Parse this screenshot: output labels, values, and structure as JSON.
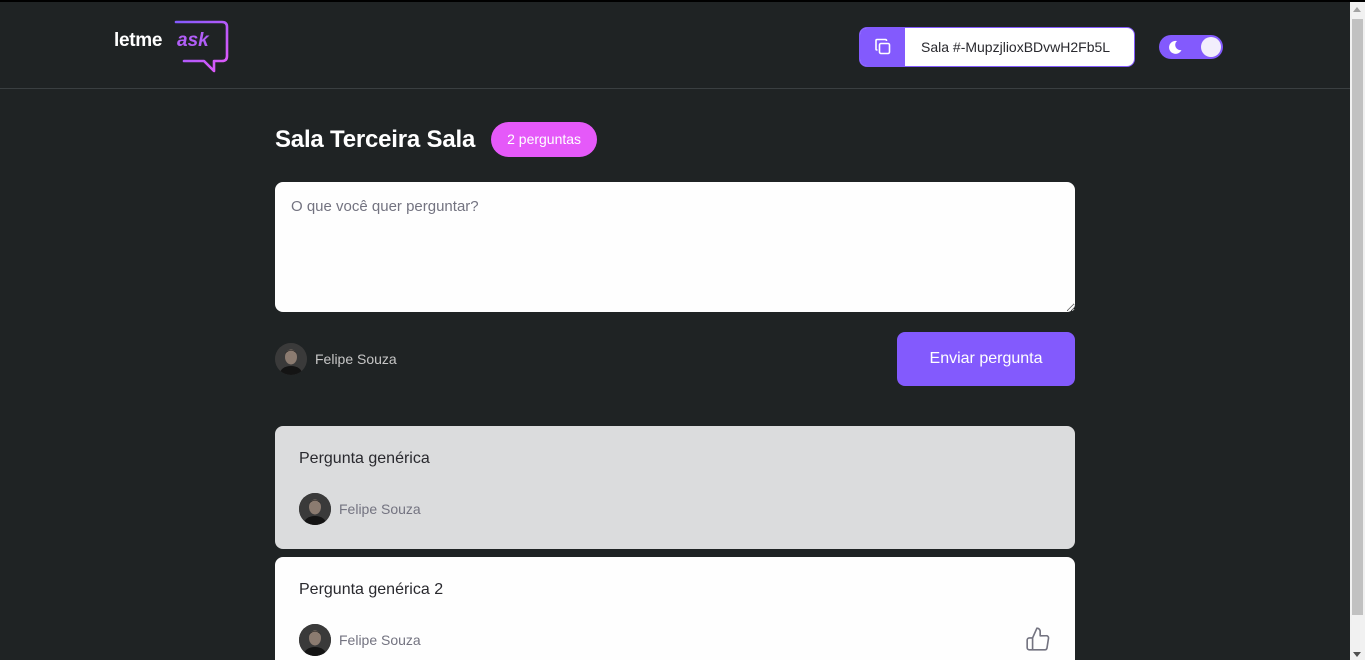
{
  "header": {
    "logo": {
      "text_primary": "letme",
      "text_accent": "ask"
    },
    "room_code": {
      "label": "Sala #-MupzjlioxBDvwH2Fb5L"
    },
    "theme_toggle": {
      "icon": "moon-icon",
      "state": "dark"
    }
  },
  "main": {
    "title": "Sala Terceira Sala",
    "question_count": "2 perguntas",
    "form": {
      "placeholder": "O que você quer perguntar?",
      "value": "",
      "user_name": "Felipe Souza",
      "submit_label": "Enviar pergunta"
    },
    "questions": [
      {
        "content": "Pergunta genérica",
        "author": "Felipe Souza",
        "highlighted": true
      },
      {
        "content": "Pergunta genérica 2",
        "author": "Felipe Souza",
        "highlighted": false,
        "like_icon": "thumbs-up-icon"
      }
    ]
  },
  "colors": {
    "background": "#1f2324",
    "accent": "#835afd",
    "badge": "#e559f9",
    "highlighted_card": "#dbdcdd",
    "card": "#fefefe"
  }
}
